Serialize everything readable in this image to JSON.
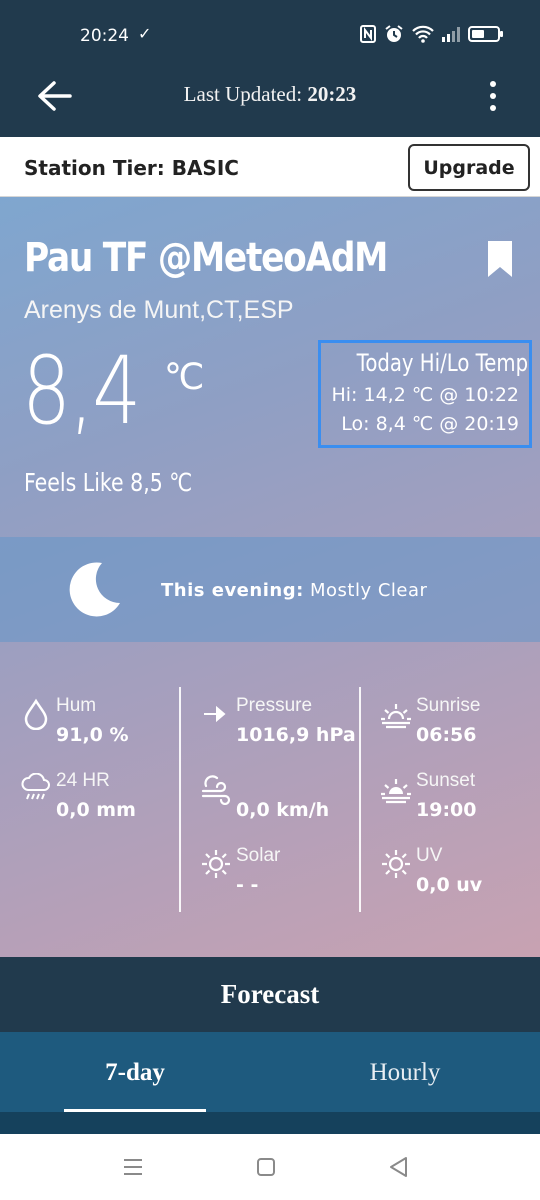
{
  "status_bar": {
    "time": "20:24",
    "check_glyph": "✓"
  },
  "app_bar": {
    "updated_label": "Last Updated: ",
    "updated_time": "20:23"
  },
  "tier": {
    "label": "Station Tier: BASIC",
    "upgrade_label": "Upgrade"
  },
  "station": {
    "name": "Pau TF @MeteoAdM",
    "location": "Arenys de Munt,CT,ESP",
    "temperature": "8,4",
    "unit": "℃",
    "feels_like": "Feels Like 8,5 ℃"
  },
  "hilo": {
    "title": "Today Hi/Lo Temp",
    "hi": "Hi: 14,2 ℃ @ 10:22",
    "lo": "Lo: 8,4 ℃ @ 20:19"
  },
  "evening": {
    "label": "This evening:",
    "condition": " Mostly Clear"
  },
  "metrics": {
    "humidity": {
      "label": "Hum",
      "value": "91,0 %"
    },
    "rain": {
      "label": "24 HR",
      "value": "0,0 mm"
    },
    "pressure": {
      "label": "Pressure",
      "value": "1016,9 hPa"
    },
    "wind": {
      "label": "",
      "value": "0,0 km/h"
    },
    "solar": {
      "label": "Solar",
      "value": "- -"
    },
    "sunrise": {
      "label": "Sunrise",
      "value": "06:56"
    },
    "sunset": {
      "label": "Sunset",
      "value": "19:00"
    },
    "uv": {
      "label": "UV",
      "value": "0,0 uv"
    }
  },
  "forecast": {
    "title": "Forecast",
    "tabs": [
      {
        "label": "7-day",
        "active": true
      },
      {
        "label": "Hourly",
        "active": false
      }
    ]
  },
  "colors": {
    "app_bar": "#213a4d",
    "tab_bar": "#1e5a7e",
    "hilo_border": "#3a8ef0"
  }
}
